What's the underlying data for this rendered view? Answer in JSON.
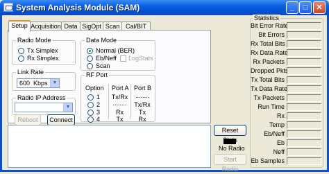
{
  "window": {
    "title": "System Analysis Module (SAM)",
    "minimize": "_",
    "maximize": "□",
    "close": "✕"
  },
  "tabs": [
    "Setup",
    "Acquisition",
    "Data",
    "SigOpt",
    "Scan",
    "Cal/BIT"
  ],
  "radio_mode": {
    "title": "Radio Mode",
    "options": [
      "Tx Simplex",
      "Rx Simplex"
    ]
  },
  "data_mode": {
    "title": "Data Mode",
    "options": [
      "Normal (BER)",
      "Eb/Neff",
      "Scan"
    ],
    "selected": "Normal (BER)",
    "logstats_label": "LogStats"
  },
  "link_rate": {
    "title": "Link Rate",
    "value": "600",
    "unit": "Kbps"
  },
  "radio_ip": {
    "title": "Radio IP Address",
    "value": ""
  },
  "buttons": {
    "reboot": "Reboot",
    "connect": "Connect",
    "reset_stats": "Reset Stats",
    "start_radio": "Start Radio"
  },
  "rf_port": {
    "title": "RF Port",
    "headers": [
      "Option",
      "Port A",
      "Port B"
    ],
    "rows": [
      {
        "option": "1",
        "a": "Tx/Rx",
        "b": "........"
      },
      {
        "option": "2",
        "a": "........",
        "b": "Tx/Rx"
      },
      {
        "option": "3",
        "a": "Rx",
        "b": "Tx"
      },
      {
        "option": "4",
        "a": "Tx",
        "b": "Rx"
      }
    ]
  },
  "radio_status": "No Radio",
  "statistics": {
    "title": "Statistics",
    "labels": [
      "Bit Error Rate",
      "Bit Errors",
      "Rx Total Bits",
      "Rx Data Rate",
      "Rx Packets",
      "Dropped Pkts",
      "Tx Total Bits",
      "Tx Data Rate",
      "Tx Packets",
      "Run Time",
      "Rx",
      "Temp",
      "Eb/Neff",
      "Eb",
      "Neff",
      "Eb Samples"
    ]
  }
}
